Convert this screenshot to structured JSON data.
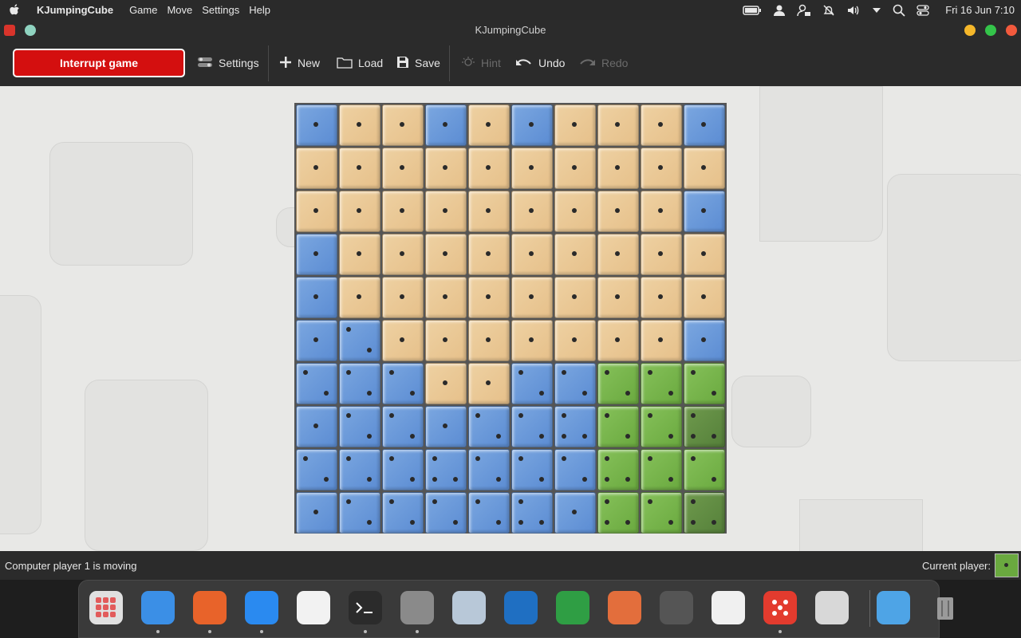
{
  "menubar": {
    "app_name": "KJumpingCube",
    "menus": [
      "Game",
      "Move",
      "Settings",
      "Help"
    ],
    "clock": "Fri 16 Jun  7:10"
  },
  "window": {
    "title": "KJumpingCube"
  },
  "toolbar": {
    "interrupt_label": "Interrupt game",
    "settings_label": "Settings",
    "new_label": "New",
    "load_label": "Load",
    "save_label": "Save",
    "hint_label": "Hint",
    "undo_label": "Undo",
    "redo_label": "Redo"
  },
  "board": {
    "size": 10,
    "colors": {
      "neutral": "#e9c690",
      "blue": "#6a98d8",
      "green": "#78b54c",
      "green_dark": "#5f8b42"
    },
    "rows": [
      [
        "B1",
        "N1",
        "N1",
        "B1",
        "N1",
        "B1",
        "N1",
        "N1",
        "N1",
        "B1"
      ],
      [
        "N1",
        "N1",
        "N1",
        "N1",
        "N1",
        "N1",
        "N1",
        "N1",
        "N1",
        "N1"
      ],
      [
        "N1",
        "N1",
        "N1",
        "N1",
        "N1",
        "N1",
        "N1",
        "N1",
        "N1",
        "B1"
      ],
      [
        "B1",
        "N1",
        "N1",
        "N1",
        "N1",
        "N1",
        "N1",
        "N1",
        "N1",
        "N1"
      ],
      [
        "B1",
        "N1",
        "N1",
        "N1",
        "N1",
        "N1",
        "N1",
        "N1",
        "N1",
        "N1"
      ],
      [
        "B1",
        "B2",
        "N1",
        "N1",
        "N1",
        "N1",
        "N1",
        "N1",
        "N1",
        "B1"
      ],
      [
        "B2",
        "B2",
        "B2",
        "N1",
        "N1",
        "B2",
        "B2",
        "G2",
        "G2",
        "G2"
      ],
      [
        "B1",
        "B2",
        "B2",
        "B1",
        "B2",
        "B2",
        "B3",
        "G2",
        "G2",
        "D3"
      ],
      [
        "B2",
        "B2",
        "B2",
        "B3",
        "B2",
        "B2",
        "B2",
        "G3",
        "G2",
        "G2"
      ],
      [
        "B1",
        "B2",
        "B2",
        "B2",
        "B2",
        "B3",
        "B1",
        "G3",
        "G2",
        "D3"
      ]
    ]
  },
  "status": {
    "message": "Computer player 1 is moving",
    "current_player_label": "Current player:",
    "current_player_pips": 1
  },
  "dock": {
    "icons": [
      {
        "name": "launchpad-icon",
        "color": "#e0e0e0",
        "running": false
      },
      {
        "name": "finder-icon",
        "color": "#3b8fe6",
        "running": true
      },
      {
        "name": "firefox-icon",
        "color": "#e8632a",
        "running": true
      },
      {
        "name": "app-store-icon",
        "color": "#2a8af0",
        "running": true
      },
      {
        "name": "photos-icon",
        "color": "#f2f2f2",
        "running": false
      },
      {
        "name": "terminal-icon",
        "color": "#2b2b2b",
        "running": true
      },
      {
        "name": "system-preferences-icon",
        "color": "#8a8a8a",
        "running": true
      },
      {
        "name": "image-viewer-icon",
        "color": "#b8c8d8",
        "running": false
      },
      {
        "name": "writer-icon",
        "color": "#1f6fc2",
        "running": false
      },
      {
        "name": "spreadsheet-icon",
        "color": "#2f9e44",
        "running": false
      },
      {
        "name": "draw-icon",
        "color": "#e36e3c",
        "running": false
      },
      {
        "name": "cassette-icon",
        "color": "#555555",
        "running": false
      },
      {
        "name": "text-editor-icon",
        "color": "#f0f0f0",
        "running": false
      },
      {
        "name": "kjumpingcube-icon",
        "color": "#e33b2e",
        "running": true
      },
      {
        "name": "calculator-icon",
        "color": "#d8d8d8",
        "running": false
      },
      {
        "name": "downloads-folder-icon",
        "color": "#4ea4e6",
        "running": false
      },
      {
        "name": "trash-icon",
        "color": "#7a7a7a",
        "running": false
      }
    ]
  }
}
